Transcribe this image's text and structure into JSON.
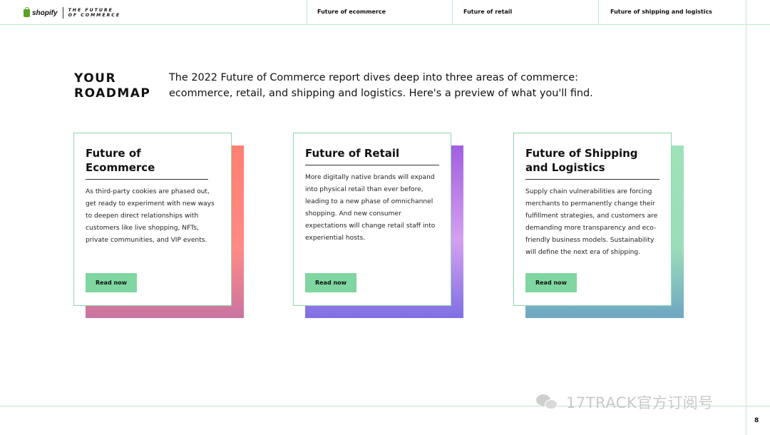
{
  "header": {
    "brand_name": "shopify",
    "tagline_line1": "THE FUTURE",
    "tagline_line2": "OF COMMERCE",
    "nav": [
      "Future of ecommerce",
      "Future of retail",
      "Future of shipping and logistics"
    ]
  },
  "roadmap": {
    "title_line1": "YOUR",
    "title_line2": "ROADMAP",
    "intro": "The 2022 Future of Commerce report dives deep into three areas of commerce: ecommerce, retail, and shipping and logistics. Here's a preview of what you'll find."
  },
  "cards": [
    {
      "title": "Future of Ecommerce",
      "body": "As third-party cookies are phased out, get ready to experiment with new ways to deepen direct relationships with customers like live shopping, NFTs, private communities, and VIP events.",
      "button": "Read now"
    },
    {
      "title": "Future of Retail",
      "body": "More digitally native brands will expand into physical retail than ever before, leading to a new phase of omnichannel shopping. And new consumer expectations will change retail staff into experiential hosts.",
      "button": "Read now"
    },
    {
      "title": "Future of Shipping and Logistics",
      "body": "Supply chain vulnerabilities are forcing merchants to permanently change their fulfillment strategies, and customers are demanding more transparency and eco-friendly business models. Sustainability will define the next era of shipping.",
      "button": "Read now"
    }
  ],
  "footer": {
    "watermark": "17TRACK官方订阅号",
    "page_number": "8"
  },
  "colors": {
    "accent_green": "#7fd6a0",
    "frame_line": "#bfe8cf",
    "card1_gradient": "#ff7f72",
    "card2_gradient": "#a25fe0",
    "card3_gradient": "#9ee3b8"
  }
}
